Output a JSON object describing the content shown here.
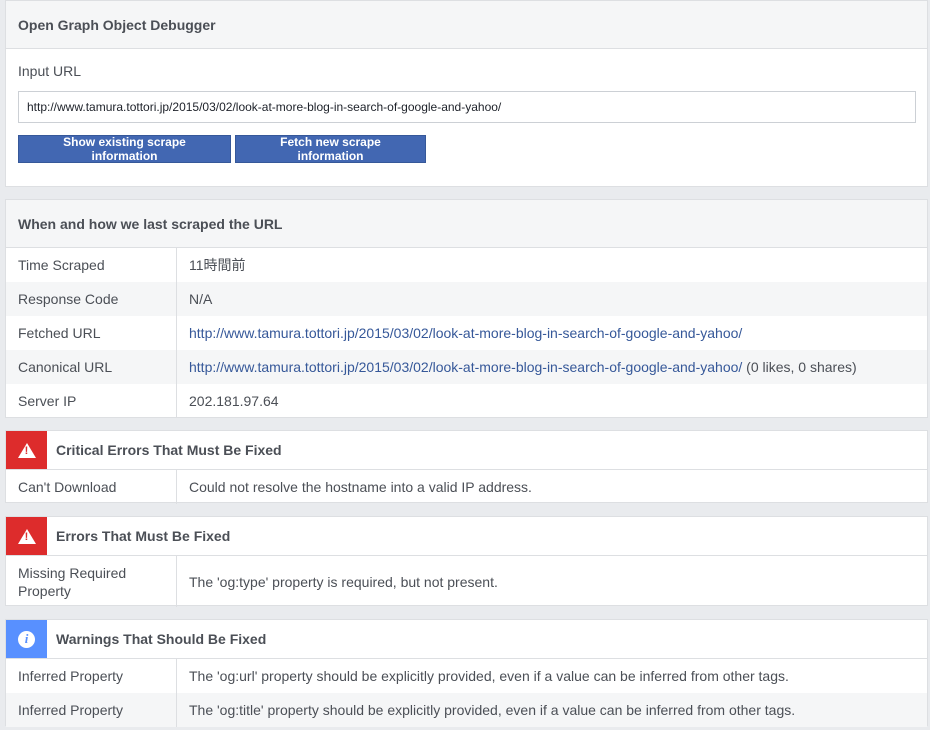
{
  "debugger": {
    "title": "Open Graph Object Debugger",
    "input_label": "Input URL",
    "input_value": "http://www.tamura.tottori.jp/2015/03/02/look-at-more-blog-in-search-of-google-and-yahoo/",
    "show_button": "Show existing scrape information",
    "fetch_button": "Fetch new scrape information"
  },
  "scrape": {
    "title": "When and how we last scraped the URL",
    "rows": [
      {
        "key": "Time Scraped",
        "value": "11時間前"
      },
      {
        "key": "Response Code",
        "value": "N/A"
      },
      {
        "key": "Fetched URL",
        "value": "http://www.tamura.tottori.jp/2015/03/02/look-at-more-blog-in-search-of-google-and-yahoo/"
      },
      {
        "key": "Canonical URL",
        "value": "http://www.tamura.tottori.jp/2015/03/02/look-at-more-blog-in-search-of-google-and-yahoo/",
        "suffix": " (0 likes, 0 shares)"
      },
      {
        "key": "Server IP",
        "value": "202.181.97.64"
      }
    ]
  },
  "critical": {
    "title": "Critical Errors That Must Be Fixed",
    "rows": [
      {
        "key": "Can't Download",
        "value": "Could not resolve the hostname into a valid IP address."
      }
    ]
  },
  "errors": {
    "title": "Errors That Must Be Fixed",
    "rows": [
      {
        "key": "Missing Required Property",
        "value": "The 'og:type' property is required, but not present."
      }
    ]
  },
  "warnings": {
    "title": "Warnings That Should Be Fixed",
    "rows": [
      {
        "key": "Inferred Property",
        "value": "The 'og:url' property should be explicitly provided, even if a value can be inferred from other tags."
      },
      {
        "key": "Inferred Property",
        "value": "The 'og:title' property should be explicitly provided, even if a value can be inferred from other tags."
      }
    ]
  },
  "icons": {
    "critical": "warning-triangle-icon",
    "errors": "warning-triangle-icon",
    "warnings": "info-icon"
  },
  "colors": {
    "button": "#4267b2",
    "link": "#365899",
    "error": "#dd2c2c",
    "info": "#5890ff"
  }
}
